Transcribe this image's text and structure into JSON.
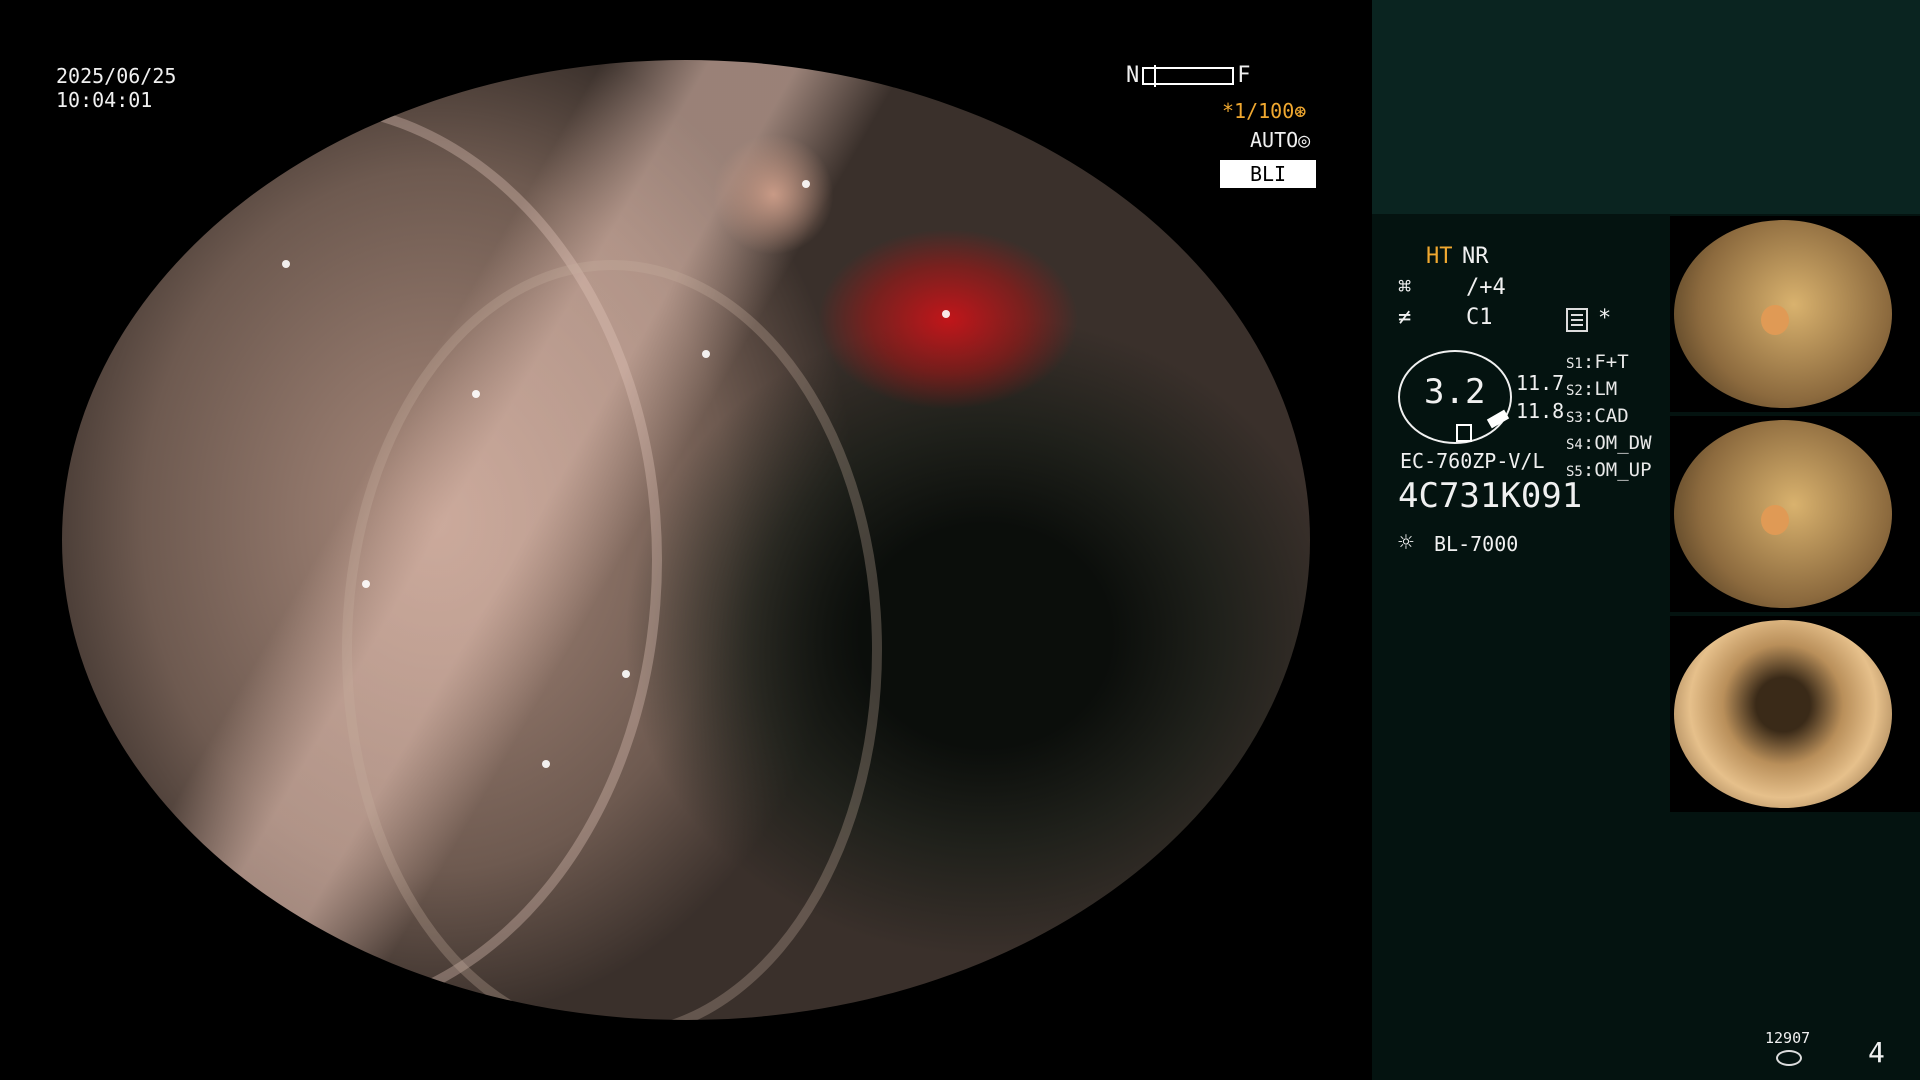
{
  "osd": {
    "date": "2025/06/25",
    "time": "10:04:01",
    "near_label": "N",
    "far_label": "F",
    "shutter": "*1/100",
    "shutter_icon": "shutter-icon",
    "iris": "AUTO",
    "iris_icon": "iris-icon",
    "mode": "BLI"
  },
  "panel": {
    "ht": "HT",
    "nr": "NR",
    "enhance_icon": "⌘",
    "enhance": "/+4",
    "color_icon": "≠",
    "color": "C1",
    "asterisk": "*",
    "zoom": "3.2",
    "value1": "11.7",
    "value2": "11.8",
    "model": "EC-760ZP-V/L",
    "serial": "4C731K091",
    "switches": [
      {
        "key": "S1",
        "value": "F+T"
      },
      {
        "key": "S2",
        "value": "LM"
      },
      {
        "key": "S3",
        "value": "CAD"
      },
      {
        "key": "S4",
        "value": "OM_DW"
      },
      {
        "key": "S5",
        "value": "OM_UP"
      }
    ],
    "lamp_icon": "☼",
    "lamp": "BL-7000",
    "counter": "12907",
    "page": "4"
  },
  "colors": {
    "panel_bg": "#041310",
    "panel_top_bg": "#0a2420",
    "accent_orange": "#f0a830"
  }
}
